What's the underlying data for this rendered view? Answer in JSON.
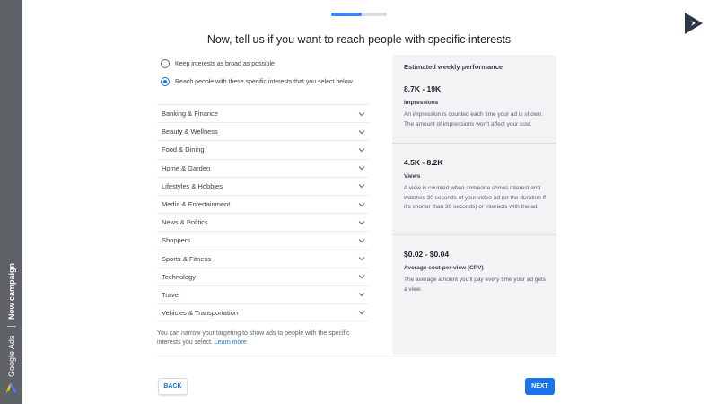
{
  "sidebar": {
    "campaign_label": "New campaign",
    "product_label": "Google Ads",
    "logo_icon": "google-ads-logo-icon"
  },
  "progress": {
    "fraction": 0.55,
    "color": "#4285f4"
  },
  "brand_icon": "play-triangle-logo-icon",
  "title": "Now, tell us if you want to reach people with specific interests",
  "radios": [
    {
      "label": "Keep interests as broad as possible",
      "selected": false
    },
    {
      "label": "Reach people with these specific interests that you select below",
      "selected": true
    }
  ],
  "categories": [
    "Banking & Finance",
    "Beauty & Wellness",
    "Food & Dining",
    "Home & Garden",
    "Lifestyles & Hobbies",
    "Media & Entertainment",
    "News & Politics",
    "Shoppers",
    "Sports & Fitness",
    "Technology",
    "Travel",
    "Vehicles & Transportation"
  ],
  "note": {
    "text": "You can narrow your targeting to show ads to people with the specific interests you select.",
    "link": "Learn more"
  },
  "panel": {
    "title": "Estimated weekly performance",
    "metrics": [
      {
        "range": "8.7K - 19K",
        "label": "Impressions",
        "description": "An impression is counted each time your ad is shown. The amount of impressions won't affect your cost."
      },
      {
        "range": "4.5K - 8.2K",
        "label": "Views",
        "description": "A view is counted when someone shows interest and watches 30 seconds of your video ad (or the duration if it's shorter than 30 seconds) or interacts with the ad."
      },
      {
        "range": "$0.02 - $0.04",
        "label": "Average cost-per-view (CPV)",
        "description": "The average amount you'll pay every time your ad gets a view."
      }
    ]
  },
  "buttons": {
    "back": "BACK",
    "next": "NEXT"
  },
  "colors": {
    "accent": "#1a73e8",
    "sidebar": "#5f6368",
    "panel": "#f1f3f4"
  }
}
